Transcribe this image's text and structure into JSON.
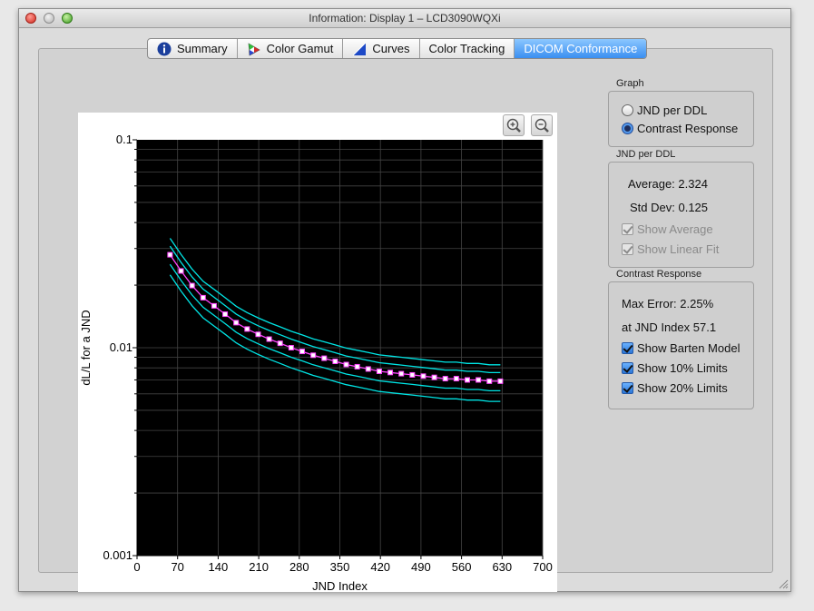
{
  "window": {
    "title": "Information: Display 1 – LCD3090WQXi"
  },
  "tabs": [
    {
      "label": "Summary",
      "icon": "info-icon"
    },
    {
      "label": "Color Gamut",
      "icon": "color-gamut-icon"
    },
    {
      "label": "Curves",
      "icon": "curves-icon"
    },
    {
      "label": "Color Tracking",
      "icon": ""
    },
    {
      "label": "DICOM Conformance",
      "icon": "",
      "active": true
    }
  ],
  "toolbar": {
    "zoom_in_icon": "zoom-in-icon",
    "zoom_out_icon": "zoom-out-icon"
  },
  "graph_group": {
    "label": "Graph",
    "options": [
      {
        "label": "JND per DDL",
        "selected": false
      },
      {
        "label": "Contrast Response",
        "selected": true
      }
    ]
  },
  "jnd_group": {
    "label": "JND per DDL",
    "average_label": "Average:",
    "average_value": "2.324",
    "std_label": "Std Dev:",
    "std_value": "0.125",
    "show_average": "Show Average",
    "show_linear_fit": "Show Linear Fit"
  },
  "contrast_group": {
    "label": "Contrast Response",
    "max_error_label": "Max Error:",
    "max_error_value": "2.25%",
    "at_jnd_label": "at JND Index",
    "at_jnd_value": "57.1",
    "checks": [
      {
        "label": "Show Barten Model",
        "checked": true
      },
      {
        "label": "Show 10% Limits",
        "checked": true
      },
      {
        "label": "Show 20% Limits",
        "checked": true
      }
    ]
  },
  "chart_data": {
    "type": "scatter",
    "xlabel": "JND Index",
    "ylabel": "dL/L for a JND",
    "xlim": [
      0,
      700
    ],
    "ylim": [
      0.001,
      0.1
    ],
    "y_scale": "log",
    "x_ticks": [
      "0",
      "70",
      "140",
      "210",
      "280",
      "350",
      "420",
      "490",
      "560",
      "630",
      "700"
    ],
    "y_ticks": [
      "0.1",
      "0.01",
      "0.001"
    ],
    "grid": true,
    "background": "#000000",
    "series": [
      {
        "style": "markers",
        "color": "#ff44ff",
        "x": [
          57,
          76,
          95,
          114,
          133,
          152,
          171,
          190,
          209,
          228,
          247,
          266,
          285,
          304,
          323,
          342,
          361,
          380,
          399,
          418,
          437,
          456,
          475,
          494,
          513,
          532,
          551,
          570,
          589,
          608,
          627
        ],
        "y": [
          0.028,
          0.0234,
          0.0199,
          0.0174,
          0.0159,
          0.0145,
          0.0132,
          0.0123,
          0.0116,
          0.011,
          0.0105,
          0.01,
          0.0096,
          0.0092,
          0.0089,
          0.0086,
          0.0083,
          0.0081,
          0.0079,
          0.0077,
          0.0076,
          0.0075,
          0.0074,
          0.0073,
          0.0072,
          0.0071,
          0.0071,
          0.007,
          0.007,
          0.0069,
          0.0069
        ]
      }
    ],
    "barten_color": "#ff44ff",
    "limit_color": "#00e5e5",
    "limit_factors": [
      0.8,
      0.9,
      1.1,
      1.2
    ]
  }
}
